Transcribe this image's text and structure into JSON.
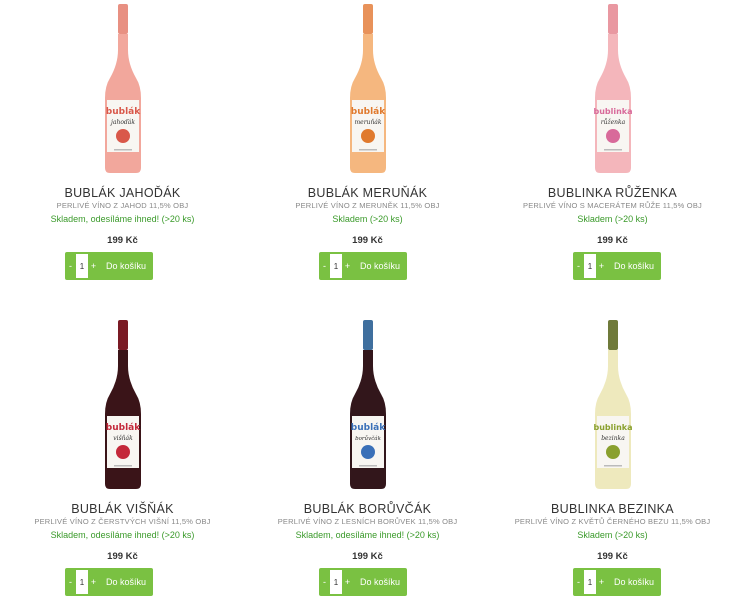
{
  "products": [
    {
      "name": "BUBLÁK JAHOĎÁK",
      "desc": "PERLIVÉ VÍNO Z JAHOD 11,5% OBJ",
      "stock": "Skladem, odesíláme ihned! (>20 ks)",
      "price": "199 Kč",
      "qty": "1",
      "add": "Do košíku",
      "label_top": "bublák",
      "label_bottom": "jahoďák",
      "wine_color": "#f2a79c",
      "cap_color": "#e89082",
      "label_color": "#d9584a"
    },
    {
      "name": "BUBLÁK MERUŇÁK",
      "desc": "PERLIVÉ VÍNO Z MERUNĚK 11,5% OBJ",
      "stock": "Skladem (>20 ks)",
      "price": "199 Kč",
      "qty": "1",
      "add": "Do košíku",
      "label_top": "bublák",
      "label_bottom": "meruňák",
      "wine_color": "#f5b77f",
      "cap_color": "#e8925a",
      "label_color": "#e07a2e"
    },
    {
      "name": "BUBLINKA RŮŽENKA",
      "desc": "PERLIVÉ VÍNO S MACERÁTEM RŮŽE 11,5% OBJ",
      "stock": "Skladem (>20 ks)",
      "price": "199 Kč",
      "qty": "1",
      "add": "Do košíku",
      "label_top": "bublinka",
      "label_bottom": "růženka",
      "wine_color": "#f4b6bb",
      "cap_color": "#e998a1",
      "label_color": "#d86a9a"
    },
    {
      "name": "BUBLÁK VIŠŇÁK",
      "desc": "PERLIVÉ VÍNO Z ČERSTVÝCH VIŠNÍ 11,5% OBJ",
      "stock": "Skladem, odesíláme ihned! (>20 ks)",
      "price": "199 Kč",
      "qty": "1",
      "add": "Do košíku",
      "label_top": "bublák",
      "label_bottom": "višňák",
      "wine_color": "#3a1418",
      "cap_color": "#7a1a24",
      "label_color": "#c4283a"
    },
    {
      "name": "BUBLÁK BORŮVČÁK",
      "desc": "PERLIVÉ VÍNO Z LESNÍCH BORŮVEK 11,5% OBJ",
      "stock": "Skladem, odesíláme ihned! (>20 ks)",
      "price": "199 Kč",
      "qty": "1",
      "add": "Do košíku",
      "label_top": "bublák",
      "label_bottom": "borůvčák",
      "wine_color": "#32161b",
      "cap_color": "#3f6f9e",
      "label_color": "#3a70b8"
    },
    {
      "name": "BUBLINKA BEZINKA",
      "desc": "PERLIVÉ VÍNO Z KVĚTŮ ČERNÉHO BEZU 11,5% OBJ",
      "stock": "Skladem (>20 ks)",
      "price": "199 Kč",
      "qty": "1",
      "add": "Do košíku",
      "label_top": "bublinka",
      "label_bottom": "bezinka",
      "wine_color": "#eee9bd",
      "cap_color": "#6f7a3a",
      "label_color": "#8aa02e"
    }
  ],
  "icons": {
    "minus": "-",
    "plus": "+"
  }
}
